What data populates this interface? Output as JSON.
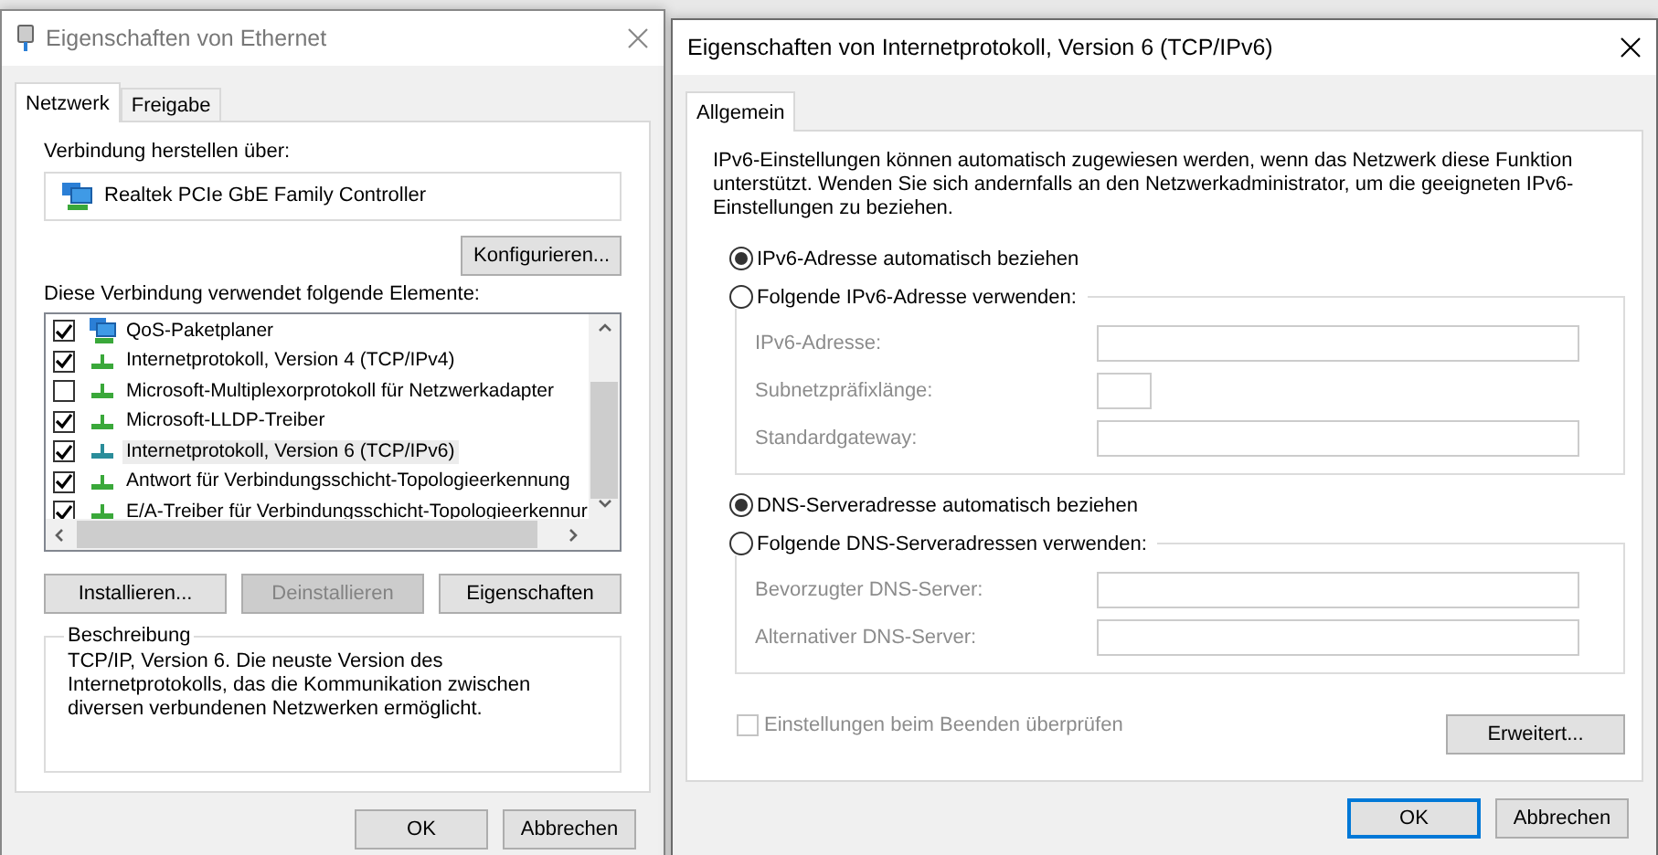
{
  "left_dialog": {
    "title": "Eigenschaften von Ethernet",
    "tabs": [
      {
        "label": "Netzwerk",
        "selected": true
      },
      {
        "label": "Freigabe",
        "selected": false
      }
    ],
    "connect_label": "Verbindung herstellen über:",
    "adapter": "Realtek PCIe GbE Family Controller",
    "configure_button": "Konfigurieren...",
    "elements_label": "Diese Verbindung verwendet folgende Elemente:",
    "elements": [
      {
        "label": "QoS-Paketplaner",
        "checked": true,
        "selected": false,
        "kind": "monitor"
      },
      {
        "label": "Internetprotokoll, Version 4 (TCP/IPv4)",
        "checked": true,
        "selected": false,
        "kind": "protocol"
      },
      {
        "label": "Microsoft-Multiplexorprotokoll für Netzwerkadapter",
        "checked": false,
        "selected": false,
        "kind": "protocol"
      },
      {
        "label": "Microsoft-LLDP-Treiber",
        "checked": true,
        "selected": false,
        "kind": "protocol"
      },
      {
        "label": "Internetprotokoll, Version 6 (TCP/IPv6)",
        "checked": true,
        "selected": true,
        "kind": "protocol"
      },
      {
        "label": "Antwort für Verbindungsschicht-Topologieerkennung",
        "checked": true,
        "selected": false,
        "kind": "protocol"
      },
      {
        "label": "E/A-Treiber für Verbindungsschicht-Topologieerkennur",
        "checked": true,
        "selected": false,
        "kind": "protocol"
      }
    ],
    "buttons": [
      {
        "label": "Installieren...",
        "disabled": false
      },
      {
        "label": "Deinstallieren",
        "disabled": true
      },
      {
        "label": "Eigenschaften",
        "disabled": false
      }
    ],
    "description": {
      "title": "Beschreibung",
      "text": "TCP/IP, Version 6. Die neuste Version des Internetprotokolls, das die Kommunikation zwischen diversen verbundenen Netzwerken ermöglicht."
    },
    "footer_buttons": [
      {
        "label": "OK",
        "default": false
      },
      {
        "label": "Abbrechen",
        "default": false
      }
    ]
  },
  "right_dialog": {
    "title": "Eigenschaften von Internetprotokoll, Version 6 (TCP/IPv6)",
    "tabs": [
      {
        "label": "Allgemein",
        "selected": true
      }
    ],
    "intro": "IPv6-Einstellungen können automatisch zugewiesen werden, wenn das Netzwerk diese Funktion unterstützt. Wenden Sie sich andernfalls an den Netzwerkadministrator, um die geeigneten IPv6-Einstellungen zu beziehen.",
    "sections": [
      {
        "auto": {
          "label": "IPv6-Adresse automatisch beziehen",
          "selected": true
        },
        "manual": {
          "label": "Folgende IPv6-Adresse verwenden:",
          "selected": false
        },
        "fields": [
          {
            "label": "IPv6-Adresse:",
            "kind": "wide",
            "disabled": true
          },
          {
            "label": "Subnetzpräfixlänge:",
            "kind": "short",
            "disabled": true
          },
          {
            "label": "Standardgateway:",
            "kind": "wide",
            "disabled": true
          }
        ]
      },
      {
        "auto": {
          "label": "DNS-Serveradresse automatisch beziehen",
          "selected": true
        },
        "manual": {
          "label": "Folgende DNS-Serveradressen verwenden:",
          "selected": false
        },
        "fields": [
          {
            "label": "Bevorzugter DNS-Server:",
            "kind": "wide",
            "disabled": true
          },
          {
            "label": "Alternativer DNS-Server:",
            "kind": "wide",
            "disabled": true
          }
        ]
      }
    ],
    "validate": {
      "label": "Einstellungen beim Beenden überprüfen",
      "checked": false,
      "disabled": true
    },
    "advanced_button": "Erweitert...",
    "footer_buttons": [
      {
        "label": "OK",
        "default": true
      },
      {
        "label": "Abbrechen",
        "default": false
      }
    ]
  }
}
